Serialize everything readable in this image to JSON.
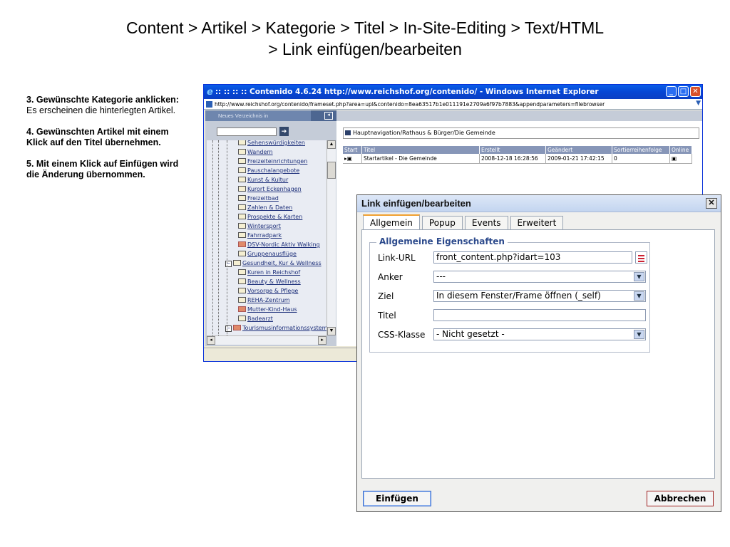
{
  "slide": {
    "title_line1": "Content > Artikel > Kategorie > Titel > In-Site-Editing > Text/HTML",
    "title_line2": "> Link einfügen/bearbeiten",
    "steps": [
      {
        "heading": "3. Gewünschte Kategorie anklicken:",
        "text": "Es erscheinen die hinterlegten Artikel."
      },
      {
        "heading": "4. Gewünschten Artikel mit einem Klick auf den Titel übernehmen.",
        "text": ""
      },
      {
        "heading": "5. Mit einem Klick auf Einfügen wird die Änderung übernommen.",
        "text": ""
      }
    ]
  },
  "browser": {
    "title": ":: :: :: :: Contenido 4.6.24 http://www.reichshof.org/contenido/ - Windows Internet Explorer",
    "address": "http://www.reichshof.org/contenido/frameset.php?area=upl&contenido=8ea63517b1e011191e2709a6f97b7883&appendparameters=filebrowser",
    "left_header": "Neues Verzeichnis in",
    "tree": [
      "Sehenswürdigkeiten",
      "Wandern",
      "Freizeiteinrichtungen",
      "Pauschalangebote",
      "Kunst & Kultur",
      "Kurort Eckenhagen",
      "Freizeitbad",
      "Zahlen & Daten",
      "Prospekte & Karten",
      "Wintersport",
      "Fahrradpark",
      "DSV-Nordic Aktiv Walking",
      "Gruppenausflüge",
      "Gesundheit, Kur & Wellness",
      "Kuren in Reichshof",
      "Beauty & Wellness",
      "Vorsorge & Pflege",
      "REHA-Zentrum",
      "Mutter-Kind-Haus",
      "Badearzt",
      "Tourismusinformationssystem"
    ],
    "breadcrumb": "Hauptnavigation/Rathaus & Bürger/Die Gemeinde",
    "table": {
      "headers": [
        "Start",
        "Titel",
        "Erstellt",
        "Geändert",
        "Sortierreihenfolge",
        "Online"
      ],
      "row": {
        "title": "Startartikel - Die Gemeinde",
        "created": "2008-12-18 16:28:56",
        "changed": "2009-01-21 17:42:15",
        "sort": "0"
      }
    }
  },
  "dialog": {
    "title": "Link einfügen/bearbeiten",
    "close": "✕",
    "tabs": [
      "Allgemein",
      "Popup",
      "Events",
      "Erweitert"
    ],
    "legend": "Allgemeine Eigenschaften",
    "fields": {
      "link_url_label": "Link-URL",
      "link_url_value": "front_content.php?idart=103",
      "anker_label": "Anker",
      "anker_value": "---",
      "ziel_label": "Ziel",
      "ziel_value": "In diesem Fenster/Frame öffnen (_self)",
      "titel_label": "Titel",
      "titel_value": "",
      "css_label": "CSS-Klasse",
      "css_value": "- Nicht gesetzt -"
    },
    "insert_label": "Einfügen",
    "cancel_label": "Abbrechen"
  },
  "colors": {
    "ie_title": "#0a5ee8",
    "legend": "#2c4a8c",
    "nav_header": "#6e86ae"
  }
}
